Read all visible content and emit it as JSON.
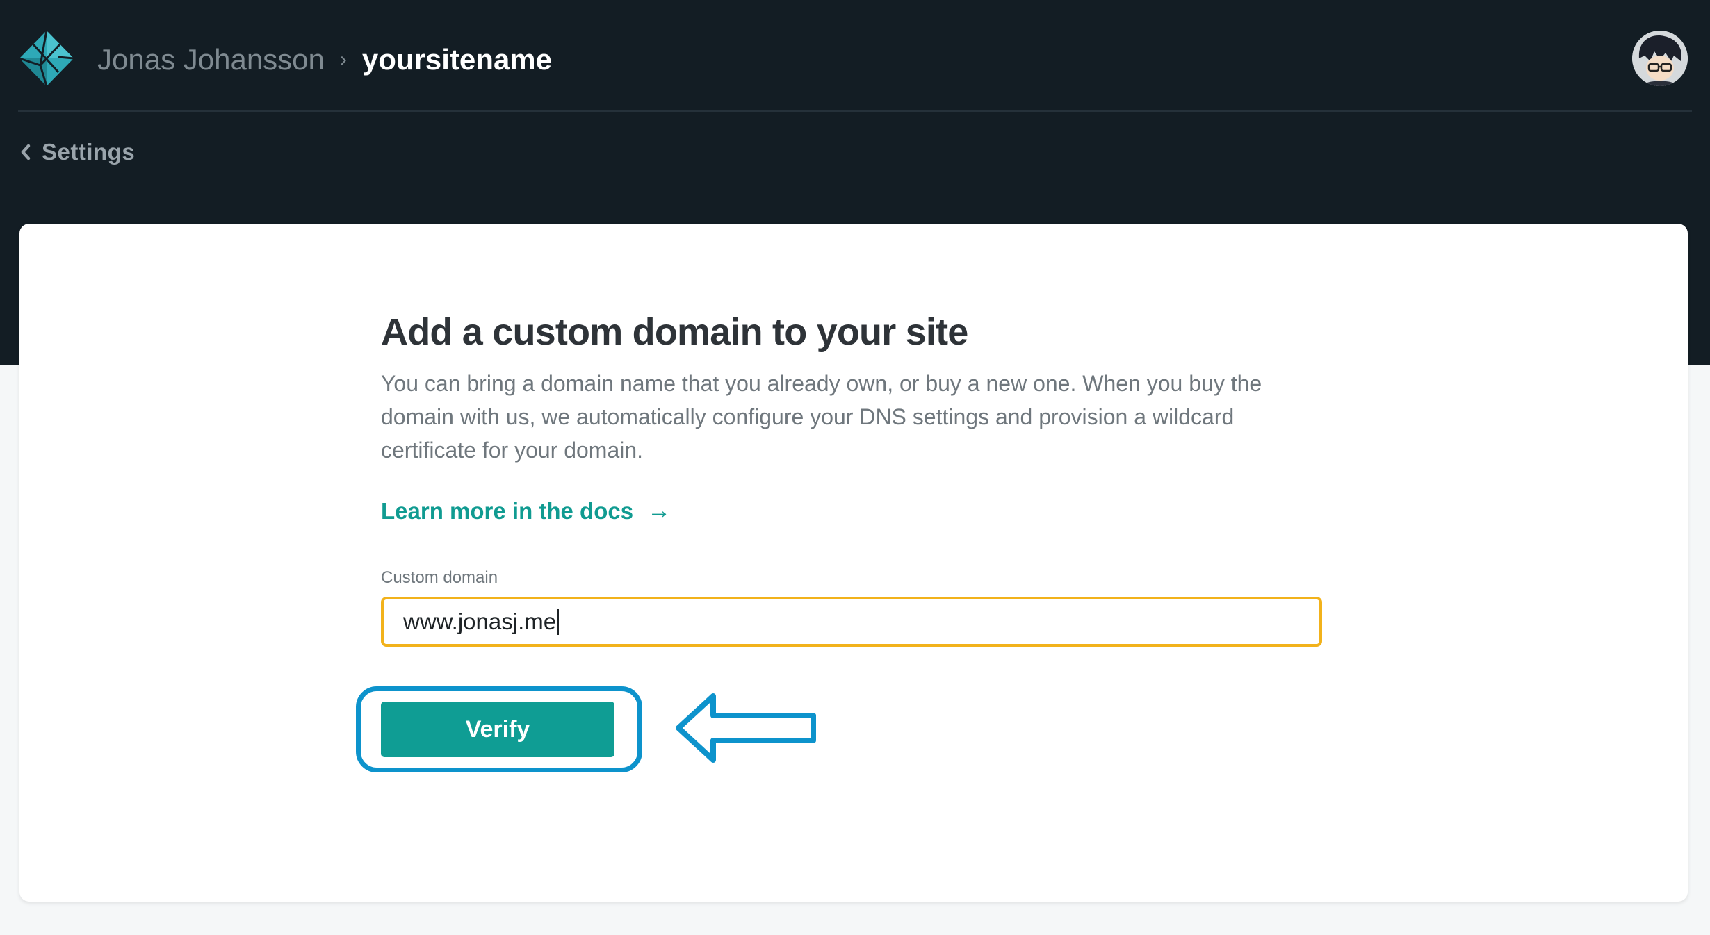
{
  "header": {
    "team_name": "Jonas Johansson",
    "separator": "›",
    "site_name": "yoursitename",
    "back_label": "Settings"
  },
  "main": {
    "title": "Add a custom domain to your site",
    "description": "You can bring a domain name that you already own, or buy a new one. When you buy the domain with us, we automatically configure your DNS settings and provision a wildcard certificate for your domain.",
    "docs_link": "Learn more in the docs",
    "docs_arrow": "→",
    "field_label": "Custom domain",
    "field_value": "www.jonasj.me",
    "verify_label": "Verify"
  },
  "icons": {
    "logo": "netlify-logo-icon",
    "back": "chevron-left-icon",
    "avatar": "user-avatar",
    "annotation": "arrow-left-icon"
  },
  "colors": {
    "header_bg": "#131d24",
    "accent": "#0f9d94",
    "input_focus": "#f2b21b",
    "annotation": "#0d93cc"
  }
}
